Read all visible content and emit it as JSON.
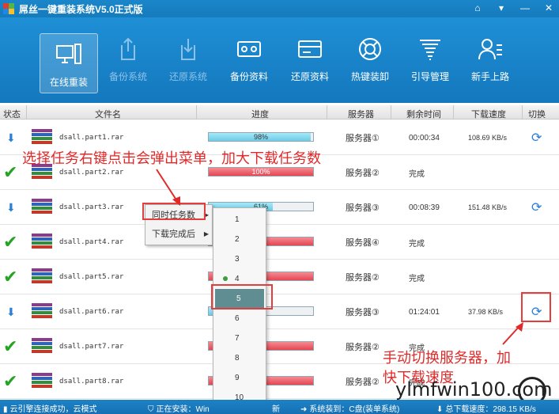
{
  "window": {
    "title": "屌丝一键重装系统V5.0正式版",
    "btn_icons": [
      "home-icon",
      "menu-icon",
      "minimize-icon",
      "close-icon"
    ]
  },
  "toolbar": {
    "items": [
      {
        "label": "在线重装",
        "icon": "computer-icon",
        "state": "active"
      },
      {
        "label": "备份系统",
        "icon": "upload-icon",
        "state": "disabled"
      },
      {
        "label": "还原系统",
        "icon": "download-icon",
        "state": "disabled"
      },
      {
        "label": "备份资料",
        "icon": "tape-icon",
        "state": "normal"
      },
      {
        "label": "还原资料",
        "icon": "card-icon",
        "state": "normal"
      },
      {
        "label": "热键装卸",
        "icon": "lifebuoy-icon",
        "state": "normal"
      },
      {
        "label": "引导管理",
        "icon": "tornado-icon",
        "state": "normal"
      },
      {
        "label": "新手上路",
        "icon": "user-icon",
        "state": "normal"
      }
    ]
  },
  "table": {
    "headers": [
      "状态",
      "文件名",
      "进度",
      "服务器",
      "剩余时间",
      "下载速度",
      "切换"
    ],
    "rows": [
      {
        "status": "downloading",
        "file": "dsall.part1.rar",
        "progress_pct": 98,
        "progress_text": "98%",
        "server": "服务器①",
        "remain": "00:00:34",
        "speed": "108.69 KB/s",
        "switch": true
      },
      {
        "status": "done",
        "file": "dsall.part2.rar",
        "progress_pct": 100,
        "progress_text": "100%",
        "server": "服务器②",
        "remain": "完成",
        "speed": "",
        "switch": false
      },
      {
        "status": "downloading",
        "file": "dsall.part3.rar",
        "progress_pct": 61,
        "progress_text": "61%",
        "server": "服务器③",
        "remain": "00:08:39",
        "speed": "151.48 KB/s",
        "switch": true
      },
      {
        "status": "done",
        "file": "dsall.part4.rar",
        "progress_pct": 100,
        "progress_text": "",
        "server": "服务器④",
        "remain": "完成",
        "speed": "",
        "switch": false
      },
      {
        "status": "done",
        "file": "dsall.part5.rar",
        "progress_pct": 100,
        "progress_text": "",
        "server": "服务器②",
        "remain": "完成",
        "speed": "",
        "switch": false
      },
      {
        "status": "downloading",
        "file": "dsall.part6.rar",
        "progress_pct": 5,
        "progress_text": "",
        "server": "服务器③",
        "remain": "01:24:01",
        "speed": "37.98 KB/s",
        "switch": true
      },
      {
        "status": "done",
        "file": "dsall.part7.rar",
        "progress_pct": 100,
        "progress_text": "",
        "server": "服务器②",
        "remain": "完成",
        "speed": "",
        "switch": false
      },
      {
        "status": "done",
        "file": "dsall.part8.rar",
        "progress_pct": 100,
        "progress_text": "",
        "server": "服务器②",
        "remain": "完成",
        "speed": "",
        "switch": false
      }
    ]
  },
  "context_menu": {
    "items": [
      {
        "label": "同时任务数"
      },
      {
        "label": "下载完成后"
      }
    ],
    "submenu": {
      "options": [
        "1",
        "2",
        "3",
        "4",
        "5",
        "6",
        "7",
        "8",
        "9",
        "10"
      ],
      "checked": "4",
      "highlighted": "5"
    }
  },
  "annotations": {
    "top": "选择任务右键点击会弹出菜单，加大下载任务数",
    "right_line1": "手动切换服务器，加",
    "right_line2": "快下载速度"
  },
  "statusbar": {
    "connection": "云引擎连接成功，云模式",
    "installing": "正在安装：Win",
    "installing_tail": "新",
    "system_to": "系统装到：C盘(装单系统)",
    "total_speed": "总下载速度：298.15 KB/s"
  },
  "watermark": "ylmfwin100.com",
  "colors": {
    "accent": "#1a86c9",
    "annotation": "#e02a2a",
    "done": "#23a423",
    "highlight": "#5f8d92"
  }
}
